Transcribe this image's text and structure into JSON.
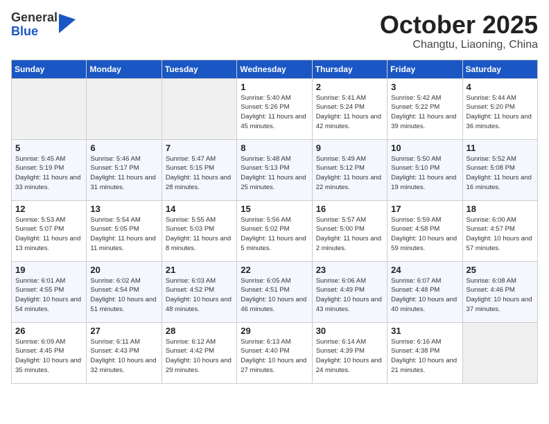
{
  "header": {
    "logo_general": "General",
    "logo_blue": "Blue",
    "month": "October 2025",
    "location": "Changtu, Liaoning, China"
  },
  "weekdays": [
    "Sunday",
    "Monday",
    "Tuesday",
    "Wednesday",
    "Thursday",
    "Friday",
    "Saturday"
  ],
  "weeks": [
    [
      {
        "day": "",
        "empty": true
      },
      {
        "day": "",
        "empty": true
      },
      {
        "day": "",
        "empty": true
      },
      {
        "day": "1",
        "sunrise": "5:40 AM",
        "sunset": "5:26 PM",
        "daylight": "11 hours and 45 minutes."
      },
      {
        "day": "2",
        "sunrise": "5:41 AM",
        "sunset": "5:24 PM",
        "daylight": "11 hours and 42 minutes."
      },
      {
        "day": "3",
        "sunrise": "5:42 AM",
        "sunset": "5:22 PM",
        "daylight": "11 hours and 39 minutes."
      },
      {
        "day": "4",
        "sunrise": "5:44 AM",
        "sunset": "5:20 PM",
        "daylight": "11 hours and 36 minutes."
      }
    ],
    [
      {
        "day": "5",
        "sunrise": "5:45 AM",
        "sunset": "5:19 PM",
        "daylight": "11 hours and 33 minutes."
      },
      {
        "day": "6",
        "sunrise": "5:46 AM",
        "sunset": "5:17 PM",
        "daylight": "11 hours and 31 minutes."
      },
      {
        "day": "7",
        "sunrise": "5:47 AM",
        "sunset": "5:15 PM",
        "daylight": "11 hours and 28 minutes."
      },
      {
        "day": "8",
        "sunrise": "5:48 AM",
        "sunset": "5:13 PM",
        "daylight": "11 hours and 25 minutes."
      },
      {
        "day": "9",
        "sunrise": "5:49 AM",
        "sunset": "5:12 PM",
        "daylight": "11 hours and 22 minutes."
      },
      {
        "day": "10",
        "sunrise": "5:50 AM",
        "sunset": "5:10 PM",
        "daylight": "11 hours and 19 minutes."
      },
      {
        "day": "11",
        "sunrise": "5:52 AM",
        "sunset": "5:08 PM",
        "daylight": "11 hours and 16 minutes."
      }
    ],
    [
      {
        "day": "12",
        "sunrise": "5:53 AM",
        "sunset": "5:07 PM",
        "daylight": "11 hours and 13 minutes."
      },
      {
        "day": "13",
        "sunrise": "5:54 AM",
        "sunset": "5:05 PM",
        "daylight": "11 hours and 11 minutes."
      },
      {
        "day": "14",
        "sunrise": "5:55 AM",
        "sunset": "5:03 PM",
        "daylight": "11 hours and 8 minutes."
      },
      {
        "day": "15",
        "sunrise": "5:56 AM",
        "sunset": "5:02 PM",
        "daylight": "11 hours and 5 minutes."
      },
      {
        "day": "16",
        "sunrise": "5:57 AM",
        "sunset": "5:00 PM",
        "daylight": "11 hours and 2 minutes."
      },
      {
        "day": "17",
        "sunrise": "5:59 AM",
        "sunset": "4:58 PM",
        "daylight": "10 hours and 59 minutes."
      },
      {
        "day": "18",
        "sunrise": "6:00 AM",
        "sunset": "4:57 PM",
        "daylight": "10 hours and 57 minutes."
      }
    ],
    [
      {
        "day": "19",
        "sunrise": "6:01 AM",
        "sunset": "4:55 PM",
        "daylight": "10 hours and 54 minutes."
      },
      {
        "day": "20",
        "sunrise": "6:02 AM",
        "sunset": "4:54 PM",
        "daylight": "10 hours and 51 minutes."
      },
      {
        "day": "21",
        "sunrise": "6:03 AM",
        "sunset": "4:52 PM",
        "daylight": "10 hours and 48 minutes."
      },
      {
        "day": "22",
        "sunrise": "6:05 AM",
        "sunset": "4:51 PM",
        "daylight": "10 hours and 46 minutes."
      },
      {
        "day": "23",
        "sunrise": "6:06 AM",
        "sunset": "4:49 PM",
        "daylight": "10 hours and 43 minutes."
      },
      {
        "day": "24",
        "sunrise": "6:07 AM",
        "sunset": "4:48 PM",
        "daylight": "10 hours and 40 minutes."
      },
      {
        "day": "25",
        "sunrise": "6:08 AM",
        "sunset": "4:46 PM",
        "daylight": "10 hours and 37 minutes."
      }
    ],
    [
      {
        "day": "26",
        "sunrise": "6:09 AM",
        "sunset": "4:45 PM",
        "daylight": "10 hours and 35 minutes."
      },
      {
        "day": "27",
        "sunrise": "6:11 AM",
        "sunset": "4:43 PM",
        "daylight": "10 hours and 32 minutes."
      },
      {
        "day": "28",
        "sunrise": "6:12 AM",
        "sunset": "4:42 PM",
        "daylight": "10 hours and 29 minutes."
      },
      {
        "day": "29",
        "sunrise": "6:13 AM",
        "sunset": "4:40 PM",
        "daylight": "10 hours and 27 minutes."
      },
      {
        "day": "30",
        "sunrise": "6:14 AM",
        "sunset": "4:39 PM",
        "daylight": "10 hours and 24 minutes."
      },
      {
        "day": "31",
        "sunrise": "6:16 AM",
        "sunset": "4:38 PM",
        "daylight": "10 hours and 21 minutes."
      },
      {
        "day": "",
        "empty": true
      }
    ]
  ],
  "labels": {
    "sunrise": "Sunrise:",
    "sunset": "Sunset:",
    "daylight": "Daylight:"
  }
}
